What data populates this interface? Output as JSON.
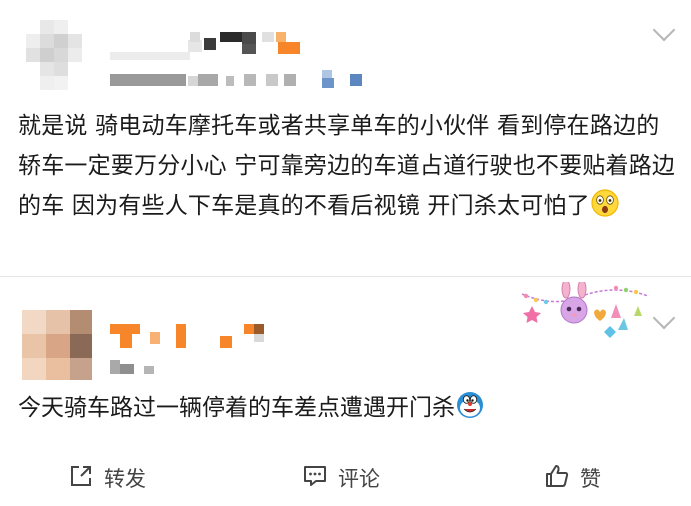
{
  "post": {
    "text": "就是说 骑电动车摩托车或者共享单车的小伙伴 看到停在路边的轿车一定要万分小心 宁可靠旁边的车道占道行驶也不要贴着路边的车 因为有些人下车是真的不看后视镜 开门杀太可怕了"
  },
  "comment": {
    "text": "今天骑车路过一辆停着的车差点遭遇开门杀"
  },
  "actions": {
    "repost_label": "转发",
    "comment_label": "评论",
    "like_label": "赞"
  },
  "icons": {
    "post_more": "chevron-down-icon",
    "comment_more": "chevron-down-icon",
    "post_emoji": "astonished-emoji-icon",
    "comment_emoji": "doraemon-emoji-icon",
    "repost": "repost-icon",
    "comment": "comment-icon",
    "like": "thumbs-up-icon",
    "decoration": "stellalou-bunting-decoration"
  },
  "colors": {
    "text": "#1b1b1b",
    "action_text": "#444444",
    "accent_orange": "#f7862a",
    "divider": "#e6e6e6"
  }
}
